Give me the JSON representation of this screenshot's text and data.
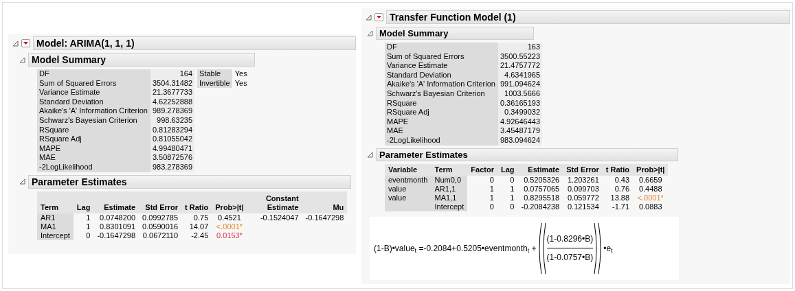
{
  "left": {
    "title": "Model: ARIMA(1, 1, 1)",
    "summary": {
      "title": "Model Summary",
      "rows": [
        {
          "label": "DF",
          "value": "164"
        },
        {
          "label": "Sum of Squared Errors",
          "value": "3504.31482"
        },
        {
          "label": "Variance Estimate",
          "value": "21.3677733"
        },
        {
          "label": "Standard Deviation",
          "value": "4.62252888"
        },
        {
          "label": "Akaike's 'A' Information Criterion",
          "value": "989.278369"
        },
        {
          "label": "Schwarz's Bayesian Criterion",
          "value": "998.63235"
        },
        {
          "label": "RSquare",
          "value": "0.81283294"
        },
        {
          "label": "RSquare Adj",
          "value": "0.81055042"
        },
        {
          "label": "MAPE",
          "value": "4.99480471"
        },
        {
          "label": "MAE",
          "value": "3.50872576"
        },
        {
          "label": "-2LogLikelihood",
          "value": "983.278369"
        }
      ],
      "side": [
        {
          "label": "Stable",
          "value": "Yes"
        },
        {
          "label": "Invertible",
          "value": "Yes"
        }
      ]
    },
    "estimates": {
      "title": "Parameter Estimates",
      "columns": [
        "Term",
        "Lag",
        "Estimate",
        "Std Error",
        "t Ratio",
        "Prob>|t|",
        "Constant Estimate",
        "Mu"
      ],
      "rows": [
        {
          "cells": [
            "AR1",
            "1",
            "0.0748200",
            "0.0992785",
            "0.75",
            "0.4521",
            "-0.1524047",
            "-0.1647298"
          ],
          "color": "#000000"
        },
        {
          "cells": [
            "MA1",
            "1",
            "0.8301091",
            "0.0590016",
            "14.07",
            "<.0001*"
          ],
          "color": "#e8862a"
        },
        {
          "cells": [
            "Intercept",
            "0",
            "-0.1647298",
            "0.0672110",
            "-2.45",
            "0.0153*"
          ],
          "color": "#e0304a"
        }
      ]
    }
  },
  "right": {
    "title": "Transfer Function Model (1)",
    "summary": {
      "title": "Model Summary",
      "rows": [
        {
          "label": "DF",
          "value": "163"
        },
        {
          "label": "Sum of Squared Errors",
          "value": "3500.55223"
        },
        {
          "label": "Variance Estimate",
          "value": "21.4757772"
        },
        {
          "label": "Standard Deviation",
          "value": "4.6341965"
        },
        {
          "label": "Akaike's 'A' Information Criterion",
          "value": "991.094624"
        },
        {
          "label": "Schwarz's Bayesian Criterion",
          "value": "1003.5666"
        },
        {
          "label": "RSquare",
          "value": "0.36165193"
        },
        {
          "label": "RSquare Adj",
          "value": "0.3499032"
        },
        {
          "label": "MAPE",
          "value": "4.92646443"
        },
        {
          "label": "MAE",
          "value": "3.45487179"
        },
        {
          "label": "-2LogLikelihood",
          "value": "983.094624"
        }
      ]
    },
    "estimates": {
      "title": "Parameter Estimates",
      "columns": [
        "Variable",
        "Term",
        "Factor",
        "Lag",
        "Estimate",
        "Std Error",
        "t Ratio",
        "Prob>|t|"
      ],
      "rows": [
        {
          "cells": [
            "eventmonth",
            "Num0,0",
            "0",
            "0",
            "0.5205326",
            "1.203261",
            "0.43",
            "0.6659"
          ],
          "color": "#000000"
        },
        {
          "cells": [
            "value",
            "AR1,1",
            "1",
            "1",
            "0.0757065",
            "0.099703",
            "0.76",
            "0.4488"
          ],
          "color": "#000000"
        },
        {
          "cells": [
            "value",
            "MA1,1",
            "1",
            "1",
            "0.8295518",
            "0.059772",
            "13.88",
            "<.0001*"
          ],
          "color": "#e8862a"
        },
        {
          "cells": [
            "",
            "Intercept",
            "0",
            "0",
            "-0.2084238",
            "0.121534",
            "-1.71",
            "0.0883"
          ],
          "color": "#000000"
        }
      ]
    },
    "formula": {
      "lhs": "(1-B)•value$_{t}$ =-0.2084+0.5205•eventmonth$_{t}$ +",
      "numerator": "(1-0.8296•B)",
      "denominator": "(1-0.0757•B)",
      "tail": "•e$_{t}$"
    }
  }
}
